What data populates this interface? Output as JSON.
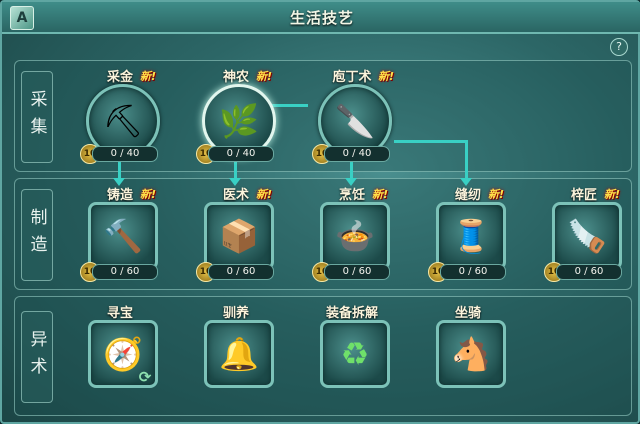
{
  "window": {
    "title": "生活技艺",
    "logo_glyph": "A",
    "close_glyph": "✕",
    "help_glyph": "?"
  },
  "rows": [
    {
      "label": "采集",
      "skills": [
        {
          "name": "采金",
          "icon": "pickaxe-icon",
          "glyph": "⛏",
          "new": "新!",
          "level": "10",
          "progress": "0 / 40",
          "fill": 0
        },
        {
          "name": "神农",
          "icon": "herb-shovel-icon",
          "glyph": "🌿",
          "new": "新!",
          "level": "10",
          "progress": "0 / 40",
          "fill": 0
        },
        {
          "name": "庖丁术",
          "icon": "butcher-knife-icon",
          "glyph": "🔪",
          "new": "新!",
          "level": "10",
          "progress": "0 / 40",
          "fill": 0
        }
      ]
    },
    {
      "label": "制造",
      "skills": [
        {
          "name": "铸造",
          "icon": "anvil-hammer-icon",
          "glyph": "🔨",
          "new": "新!",
          "level": "10",
          "progress": "0 / 60",
          "fill": 0
        },
        {
          "name": "医术",
          "icon": "medicine-box-icon",
          "glyph": "📦",
          "new": "新!",
          "level": "10",
          "progress": "0 / 60",
          "fill": 0
        },
        {
          "name": "烹饪",
          "icon": "cooking-wok-icon",
          "glyph": "🍲",
          "new": "新!",
          "level": "10",
          "progress": "0 / 60",
          "fill": 0
        },
        {
          "name": "缝纫",
          "icon": "sewing-spool-icon",
          "glyph": "🧵",
          "new": "新!",
          "level": "10",
          "progress": "0 / 60",
          "fill": 0
        },
        {
          "name": "梓匠",
          "icon": "carpenter-plane-icon",
          "glyph": "🪚",
          "new": "新!",
          "level": "10",
          "progress": "0 / 60",
          "fill": 0
        }
      ]
    },
    {
      "label": "异术",
      "skills": [
        {
          "name": "寻宝",
          "icon": "treasure-compass-icon",
          "glyph": "🧭"
        },
        {
          "name": "驯养",
          "icon": "bells-icon",
          "glyph": "🔔"
        },
        {
          "name": "装备拆解",
          "icon": "equipment-dismantle-icon",
          "glyph": "♻"
        },
        {
          "name": "坐骑",
          "icon": "horse-mount-icon",
          "glyph": "🐴"
        }
      ]
    }
  ],
  "colors": {
    "accent": "#39d0c4",
    "new_badge": "#ffe24a",
    "panel": "#2c6666"
  }
}
